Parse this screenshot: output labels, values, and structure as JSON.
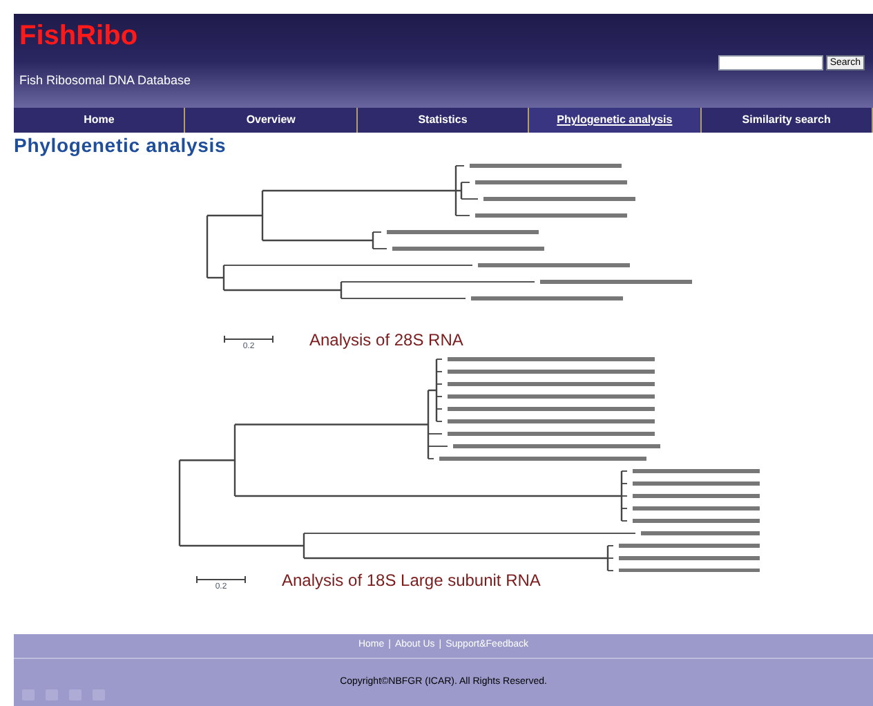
{
  "header": {
    "logo": "FishRibo",
    "subtitle": "Fish Ribosomal DNA Database",
    "search": {
      "button": "Search"
    }
  },
  "nav": [
    {
      "label": "Home",
      "selected": false
    },
    {
      "label": "Overview",
      "selected": false
    },
    {
      "label": "Statistics",
      "selected": false
    },
    {
      "label": "Phylogenetic analysis",
      "selected": true
    },
    {
      "label": "Similarity search",
      "selected": false
    }
  ],
  "heading": "Phylogenetic analysis",
  "figures": [
    {
      "scale": "0.2",
      "caption": "Analysis of 28S RNA"
    },
    {
      "scale": "0.2",
      "caption": "Analysis of 18S Large subunit RNA"
    }
  ],
  "footer": {
    "separator": "|",
    "links": [
      "Home",
      "About Us",
      "Support&Feedback"
    ],
    "copyright": "Copyright©NBFGR (ICAR). All Rights Reserved."
  }
}
